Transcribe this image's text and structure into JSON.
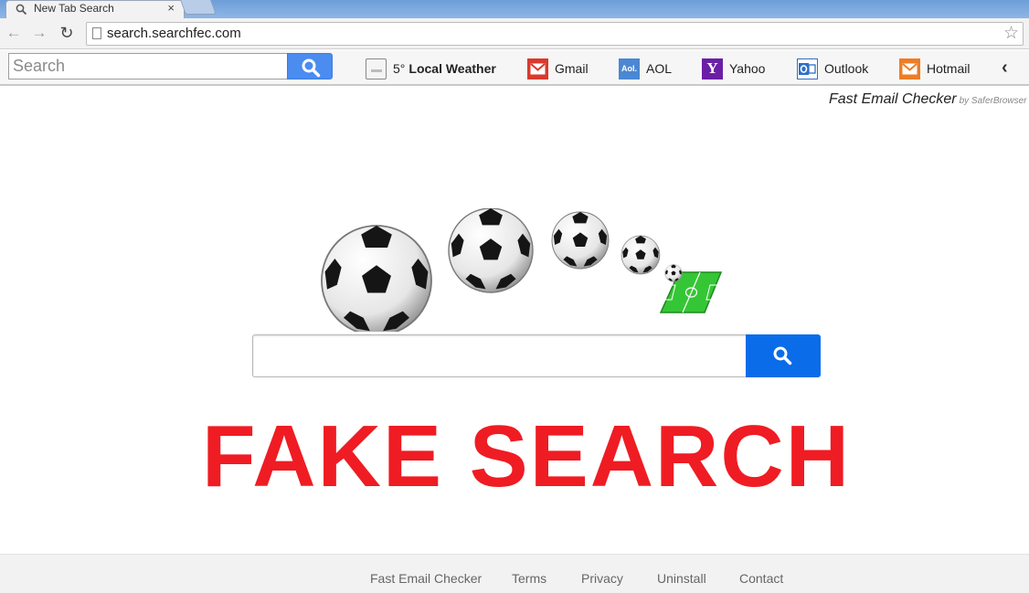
{
  "browser": {
    "tab_title": "New Tab Search",
    "tab_close": "×",
    "url": "search.searchfec.com"
  },
  "ext_toolbar": {
    "search_placeholder": "Search",
    "weather_temp": "5°",
    "weather_label": "Local Weather",
    "links": {
      "gmail": "Gmail",
      "aol": "AOL",
      "aol_icon_text": "Aol.",
      "yahoo": "Yahoo",
      "yahoo_icon_text": "Y",
      "outlook": "Outlook",
      "hotmail": "Hotmail"
    },
    "collapse_glyph": "‹"
  },
  "page": {
    "brand_name": "Fast Email Checker",
    "brand_by": "by SaferBrowser",
    "overlay_text": "FAKE SEARCH"
  },
  "footer": {
    "links": [
      "Fast Email Checker",
      "Terms",
      "Privacy",
      "Uninstall",
      "Contact"
    ]
  },
  "colors": {
    "search_button": "#4a8cf0",
    "main_button": "#0a6ce8",
    "overlay_red": "#ef1c23"
  }
}
